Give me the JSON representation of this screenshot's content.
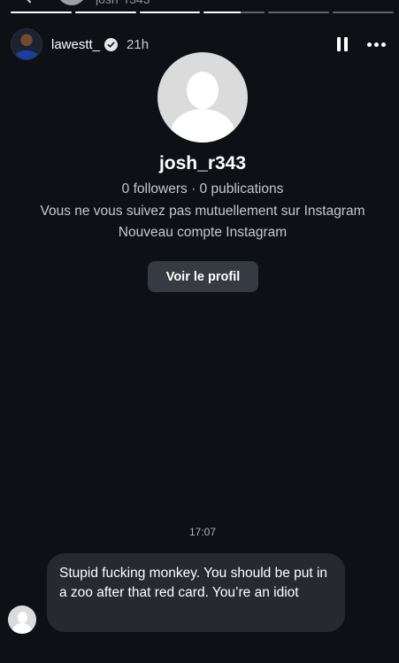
{
  "story": {
    "progress_segments": [
      1,
      1,
      1,
      0.6,
      0,
      0
    ],
    "username": "lawestt_",
    "time_ago": "21h"
  },
  "profile": {
    "name": "josh_r343",
    "stats": "0 followers · 0 publications",
    "mutual": "Vous ne vous suivez pas mutuellement sur Instagram",
    "account_note": "Nouveau compte Instagram",
    "view_profile_label": "Voir le profil"
  },
  "message": {
    "time": "17:07",
    "text": "Stupid fucking monkey. You should be put in a zoo after that red card. You’re an idiot"
  }
}
